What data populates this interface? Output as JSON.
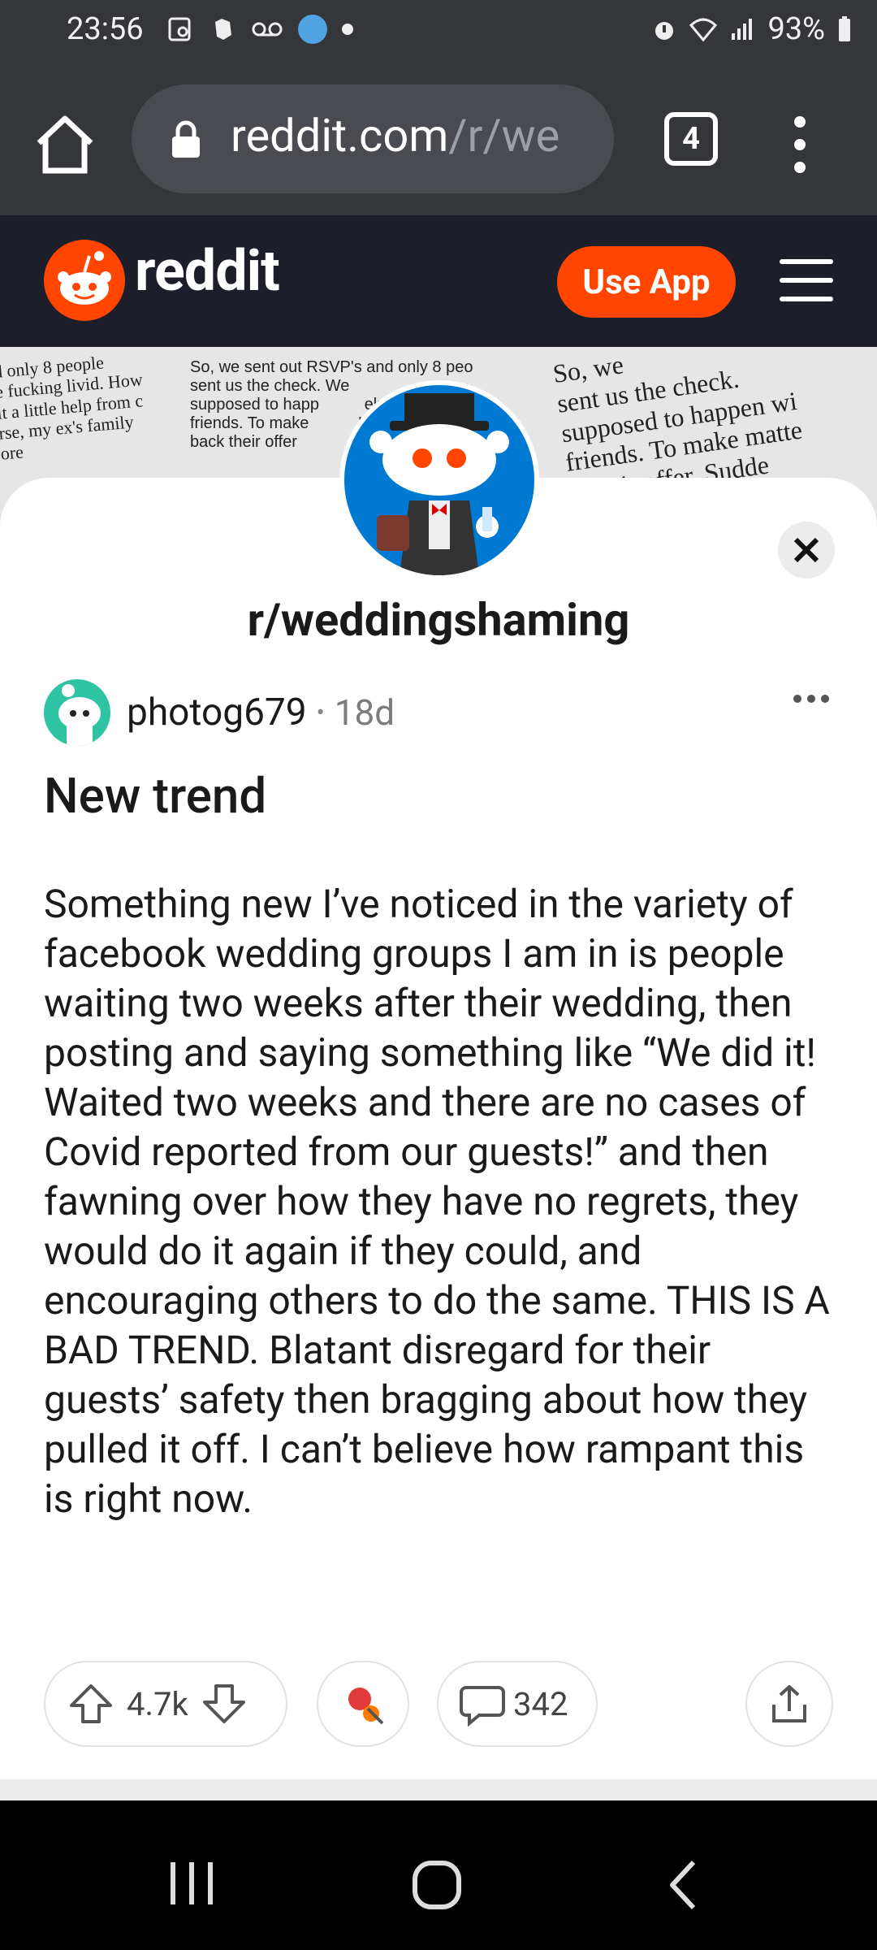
{
  "status_bar": {
    "time": "23:56",
    "battery": "93%",
    "icons_left": [
      "screenshot-icon",
      "evernote-icon",
      "voicemail-icon",
      "location-badge-icon",
      "notification-dot-icon"
    ],
    "icons_right": [
      "alarm-icon",
      "wifi-icon",
      "signal-icon",
      "battery-icon"
    ]
  },
  "browser": {
    "url_host": "reddit.com",
    "url_path": "/r/we",
    "tab_count": "4"
  },
  "reddit_header": {
    "wordmark": "reddit",
    "use_app_label": "Use App",
    "accent": "#ff4500"
  },
  "banner": {
    "col1": "d only 8 people     \ne fucking livid. How\nit a little help from c\nrse, my ex's family\nore ",
    "col2": "So, we sent out RSVP's and only 8 peo\nsent us the check. We\nsupposed to happ          elp\nfriends. To make           's\nback their offer",
    "col3": "So, we\nsent us the check.\nsupposed to happen wi\nfriends. To make matte\n        ir offer. Sudde"
  },
  "subreddit": {
    "name": "r/weddingshaming"
  },
  "post": {
    "username": "photog679",
    "separator": "•",
    "age": "18d",
    "title": "New trend",
    "body": "Something new I’ve noticed in the variety of facebook wedding groups I am in is people waiting two weeks after their wedding, then posting and saying something like “We did it! Waited two weeks and there are no cases of Covid reported from our guests!” and then fawning over how they have no regrets, they would do it again if they could, and encouraging others to do the same. THIS IS A BAD TREND. Blatant disregard for their guests’ safety then bragging about how they pulled it off. I can’t believe how rampant this is right now.",
    "upvotes": "4.7k",
    "comments": "342"
  },
  "nav": {
    "items": [
      "recents-button",
      "home-button",
      "back-button"
    ]
  }
}
